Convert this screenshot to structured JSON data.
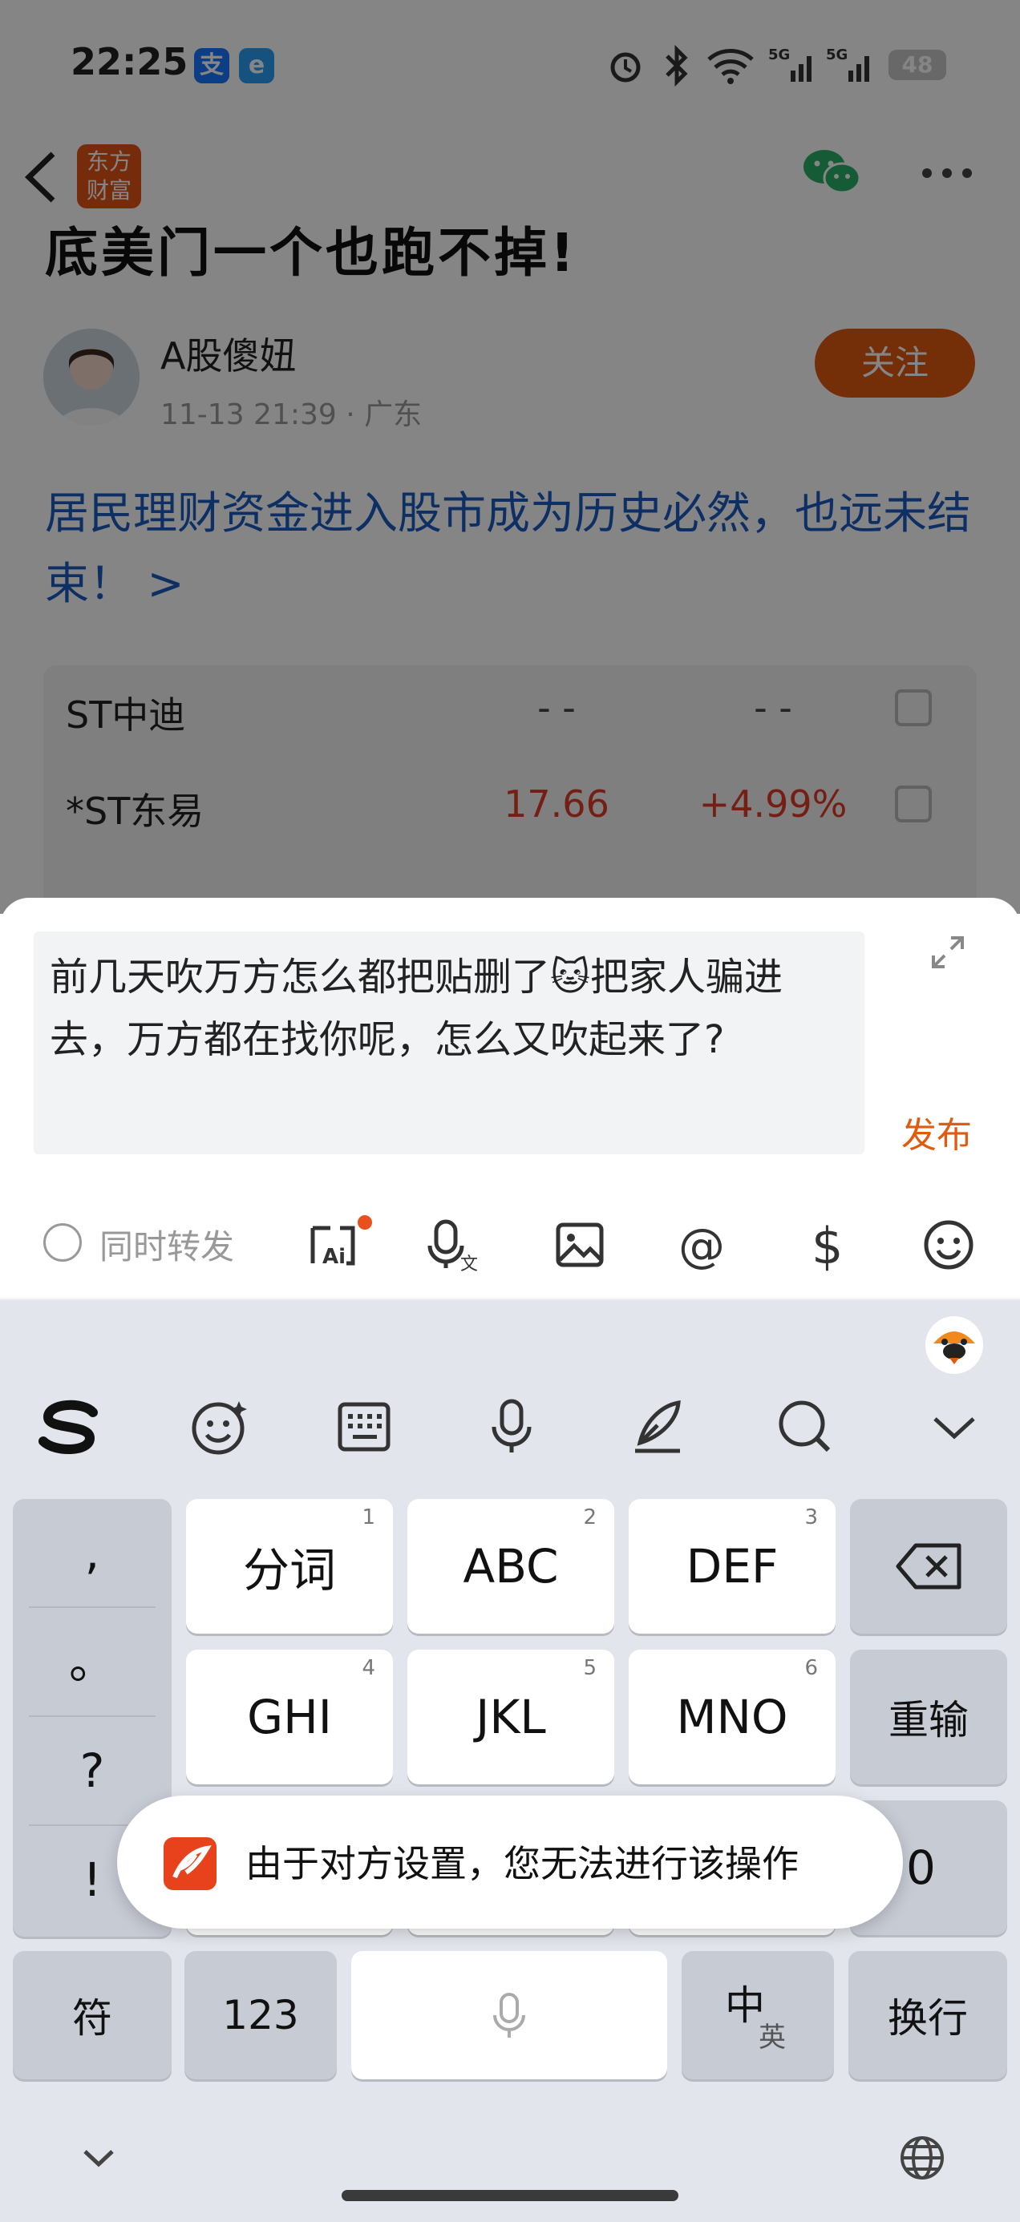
{
  "status_bar": {
    "time": "22:25",
    "battery": "48"
  },
  "header": {
    "logo_line1": "东方",
    "logo_line2": "财富"
  },
  "article": {
    "title_fragment": "底美门一个也跑不掉!",
    "author": "A股傻妞",
    "timestamp": "11-13 21:39",
    "location": "· 广东",
    "follow_label": "关注",
    "headline": "居民理财资金进入股市成为历史必然，也远未结束！ >"
  },
  "stocks": [
    {
      "name": "ST中迪",
      "price": "- -",
      "change": "- -"
    },
    {
      "name": "*ST东易",
      "price": "17.66",
      "change": "+4.99%"
    }
  ],
  "compose": {
    "text": "前几天吹万方怎么都把贴删了🐱把家人骗进去，万方都在找你呢，怎么又吹起来了?",
    "publish_label": "发布",
    "repost_label": "同时转发"
  },
  "keyboard": {
    "punct": [
      ",",
      "。",
      "?",
      "!"
    ],
    "rows": [
      [
        {
          "label": "分词",
          "num": "1"
        },
        {
          "label": "ABC",
          "num": "2"
        },
        {
          "label": "DEF",
          "num": "3"
        }
      ],
      [
        {
          "label": "GHI",
          "num": "4"
        },
        {
          "label": "JKL",
          "num": "5"
        },
        {
          "label": "MNO",
          "num": "6"
        }
      ]
    ],
    "reinput_label": "重输",
    "zero_label": "0",
    "symbol_label": "符",
    "num_label": "123",
    "lang_main": "中",
    "lang_sub": "英",
    "enter_label": "换行"
  },
  "toast": {
    "text": "由于对方设置，您无法进行该操作"
  },
  "colors": {
    "accent": "#e05a10",
    "link": "#1c5bbf",
    "up": "#e03c28"
  }
}
